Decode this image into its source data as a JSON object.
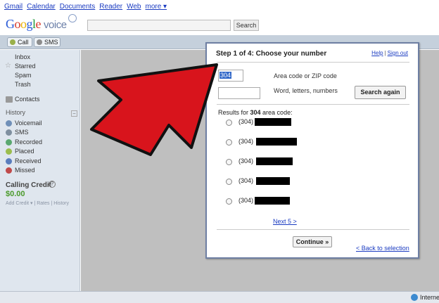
{
  "topnav": {
    "links": [
      "Gmail",
      "Calendar",
      "Documents",
      "Reader",
      "Web"
    ],
    "more": "more ▾"
  },
  "header": {
    "logo": {
      "google": "Google",
      "voice": "voice"
    },
    "search_button": "Search"
  },
  "toolbar": {
    "call": "Call",
    "sms": "SMS"
  },
  "sidebar": {
    "folders": [
      "Inbox",
      "Starred",
      "Spam",
      "Trash"
    ],
    "contacts": "Contacts",
    "history": "History",
    "history_collapse": "−",
    "history_items": [
      "Voicemail",
      "SMS",
      "Recorded",
      "Placed",
      "Received",
      "Missed"
    ],
    "history_colors": [
      "#6f8fb8",
      "#7f8f9f",
      "#5aa870",
      "#9bbd4d",
      "#5a7dbd",
      "#c04a4a"
    ],
    "credit": {
      "title": "Calling Credit",
      "help": "?",
      "amount": "$0.00",
      "links": "Add Credit ▾ | Rates | History"
    }
  },
  "dialog": {
    "title": "Step 1 of 4: Choose your number",
    "help": "Help",
    "separator": "|",
    "signout": "Sign out",
    "area_code_value": "304",
    "area_code_label": "Area code or ZIP code",
    "word_label": "Word, letters, numbers",
    "search_again": "Search again",
    "results_prefix": "Results for ",
    "results_code": "304",
    "results_suffix": " area code:",
    "options": [
      {
        "prefix": "(304)"
      },
      {
        "prefix": "(304)"
      },
      {
        "prefix": "(304)"
      },
      {
        "prefix": "(304)"
      },
      {
        "prefix": "(304)"
      }
    ],
    "next": "Next 5 >",
    "continue": "Continue »",
    "back": "< Back to selection"
  },
  "status_bar": {
    "zone": "Internet"
  },
  "colors": {
    "arrow": "#d8141c",
    "link": "#1a3bc1",
    "dialog_border": "#6e7fa3"
  }
}
